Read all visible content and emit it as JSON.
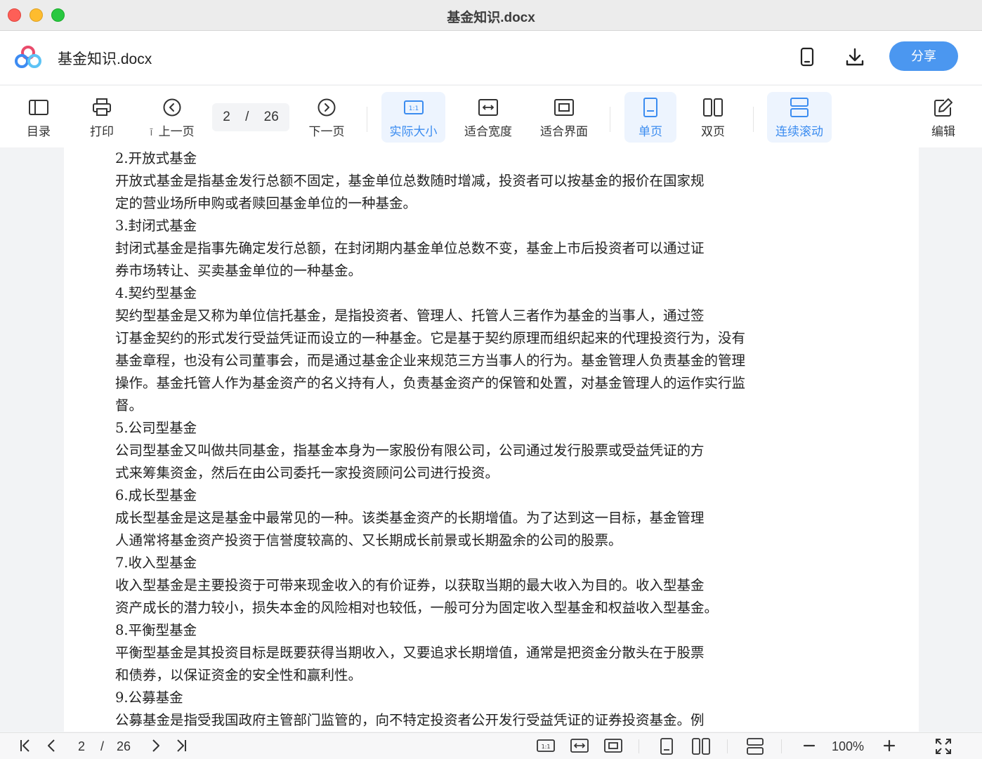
{
  "window": {
    "title": "基金知识.docx"
  },
  "header": {
    "doc_name": "基金知识.docx",
    "share_label": "分享"
  },
  "toolbar": {
    "toc": "目录",
    "print": "打印",
    "prev": "上一页",
    "prev_clip": "ī",
    "current_page": "2",
    "separator": "/",
    "total_pages": "26",
    "next": "下一页",
    "actual_size": "实际大小",
    "fit_width": "适合宽度",
    "fit_window": "适合界面",
    "single_page": "单页",
    "double_page": "双页",
    "continuous": "连续滚动",
    "edit": "编辑"
  },
  "document": {
    "lines": [
      "2.开放式基金",
      "开放式基金是指基金发行总额不固定，基金单位总数随时增减，投资者可以按基金的报价在国家规",
      "定的营业场所申购或者赎回基金单位的一种基金。",
      "3.封闭式基金",
      "封闭式基金是指事先确定发行总额，在封闭期内基金单位总数不变，基金上市后投资者可以通过证",
      "券市场转让、买卖基金单位的一种基金。",
      "4.契约型基金",
      "契约型基金是又称为单位信托基金，是指投资者、管理人、托管人三者作为基金的当事人，通过签",
      "订基金契约的形式发行受益凭证而设立的一种基金。它是基于契约原理而组织起来的代理投资行为，没有",
      "基金章程，也没有公司董事会，而是通过基金企业来规范三方当事人的行为。基金管理人负责基金的管理",
      "操作。基金托管人作为基金资产的名义持有人，负责基金资产的保管和处置，对基金管理人的运作实行监",
      "督。",
      "5.公司型基金",
      "公司型基金又叫做共同基金，指基金本身为一家股份有限公司，公司通过发行股票或受益凭证的方",
      "式来筹集资金，然后在由公司委托一家投资顾问公司进行投资。",
      "6.成长型基金",
      "成长型基金是这是基金中最常见的一种。该类基金资产的长期增值。为了达到这一目标，基金管理",
      "人通常将基金资产投资于信誉度较高的、又长期成长前景或长期盈余的公司的股票。",
      "7.收入型基金",
      "收入型基金是主要投资于可带来现金收入的有价证券，以获取当期的最大收入为目的。收入型基金",
      "资产成长的潜力较小，损失本金的风险相对也较低，一般可分为固定收入型基金和权益收入型基金。",
      "8.平衡型基金",
      "平衡型基金是其投资目标是既要获得当期收入，又要追求长期增值，通常是把资金分散头在于股票",
      "和债券，以保证资金的安全性和赢利性。",
      "9.公募基金",
      "公募基金是指受我国政府主管部门监管的，向不特定投资者公开发行受益凭证的证券投资基金。例"
    ]
  },
  "statusbar": {
    "current_page": "2",
    "separator": "/",
    "total_pages": "26",
    "zoom": "100%"
  },
  "colors": {
    "accent": "#4b97f0",
    "active_bg": "#edf4fe",
    "active_text": "#3b8cf0"
  }
}
